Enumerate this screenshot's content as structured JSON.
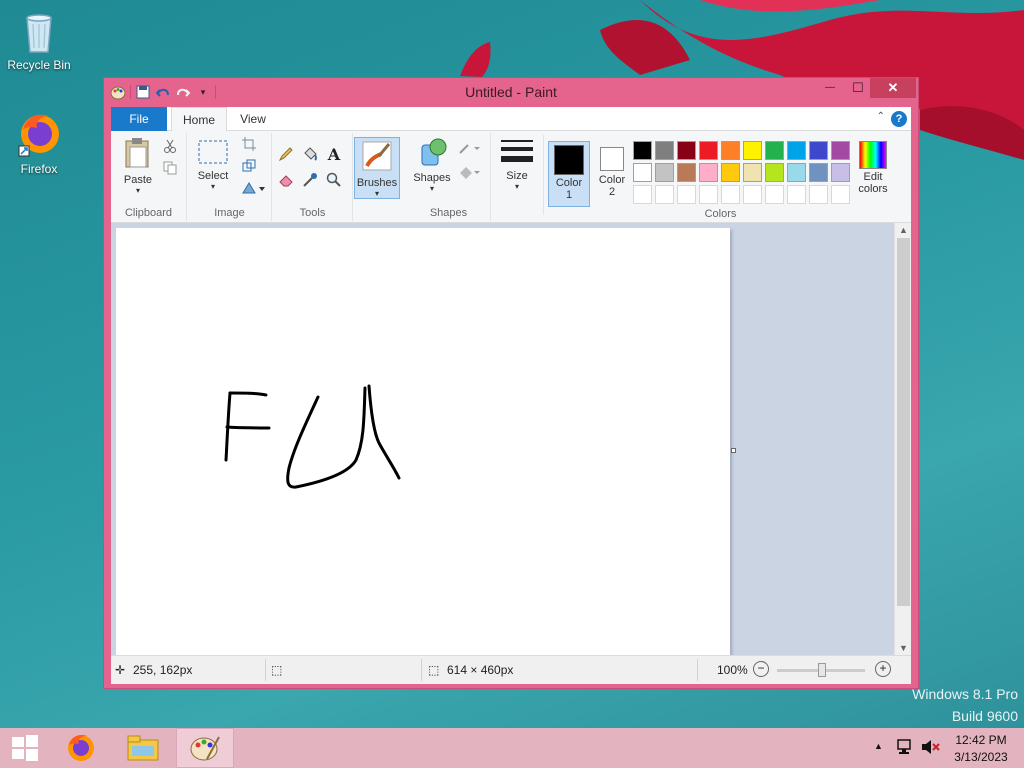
{
  "desktop": {
    "icons": [
      {
        "label": "Recycle Bin"
      },
      {
        "label": "Firefox"
      }
    ],
    "watermark": {
      "line1": "Windows 8.1 Pro",
      "line2": "Build 9600"
    }
  },
  "window": {
    "title": "Untitled - Paint",
    "controls": {
      "minimize": "—",
      "maximize": "☐",
      "close": "✕"
    }
  },
  "ribbon": {
    "tabs": [
      {
        "label": "File"
      },
      {
        "label": "Home"
      },
      {
        "label": "View"
      }
    ],
    "help": "?",
    "groups": {
      "clipboard": {
        "label": "Clipboard",
        "paste": "Paste"
      },
      "image": {
        "label": "Image",
        "select": "Select"
      },
      "tools": {
        "label": "Tools"
      },
      "brushes": {
        "label": "Brushes"
      },
      "shapes": {
        "label": "Shapes",
        "shapes_btn": "Shapes"
      },
      "size": {
        "label": "Size"
      },
      "colors": {
        "label": "Colors",
        "color1": "Color",
        "color1_num": "1",
        "color2": "Color",
        "color2_num": "2",
        "edit_colors": "Edit",
        "edit_colors2": "colors",
        "current_color1": "#000000",
        "current_color2": "#ffffff",
        "palette_row1": [
          "#000000",
          "#7f7f7f",
          "#880015",
          "#ed1c24",
          "#ff7f27",
          "#fff200",
          "#22b14c",
          "#00a2e8",
          "#3f48cc",
          "#a349a4"
        ],
        "palette_row2": [
          "#ffffff",
          "#c3c3c3",
          "#b97a57",
          "#ffaec9",
          "#ffc90e",
          "#efe4b0",
          "#b5e61d",
          "#99d9ea",
          "#7092be",
          "#c8bfe7"
        ]
      }
    }
  },
  "statusbar": {
    "cursor_pos": "255, 162px",
    "canvas_size": "614 × 460px",
    "zoom": "100%",
    "zoom_level": 1.0
  },
  "taskbar": {
    "time": "12:42 PM",
    "date": "3/13/2023"
  }
}
